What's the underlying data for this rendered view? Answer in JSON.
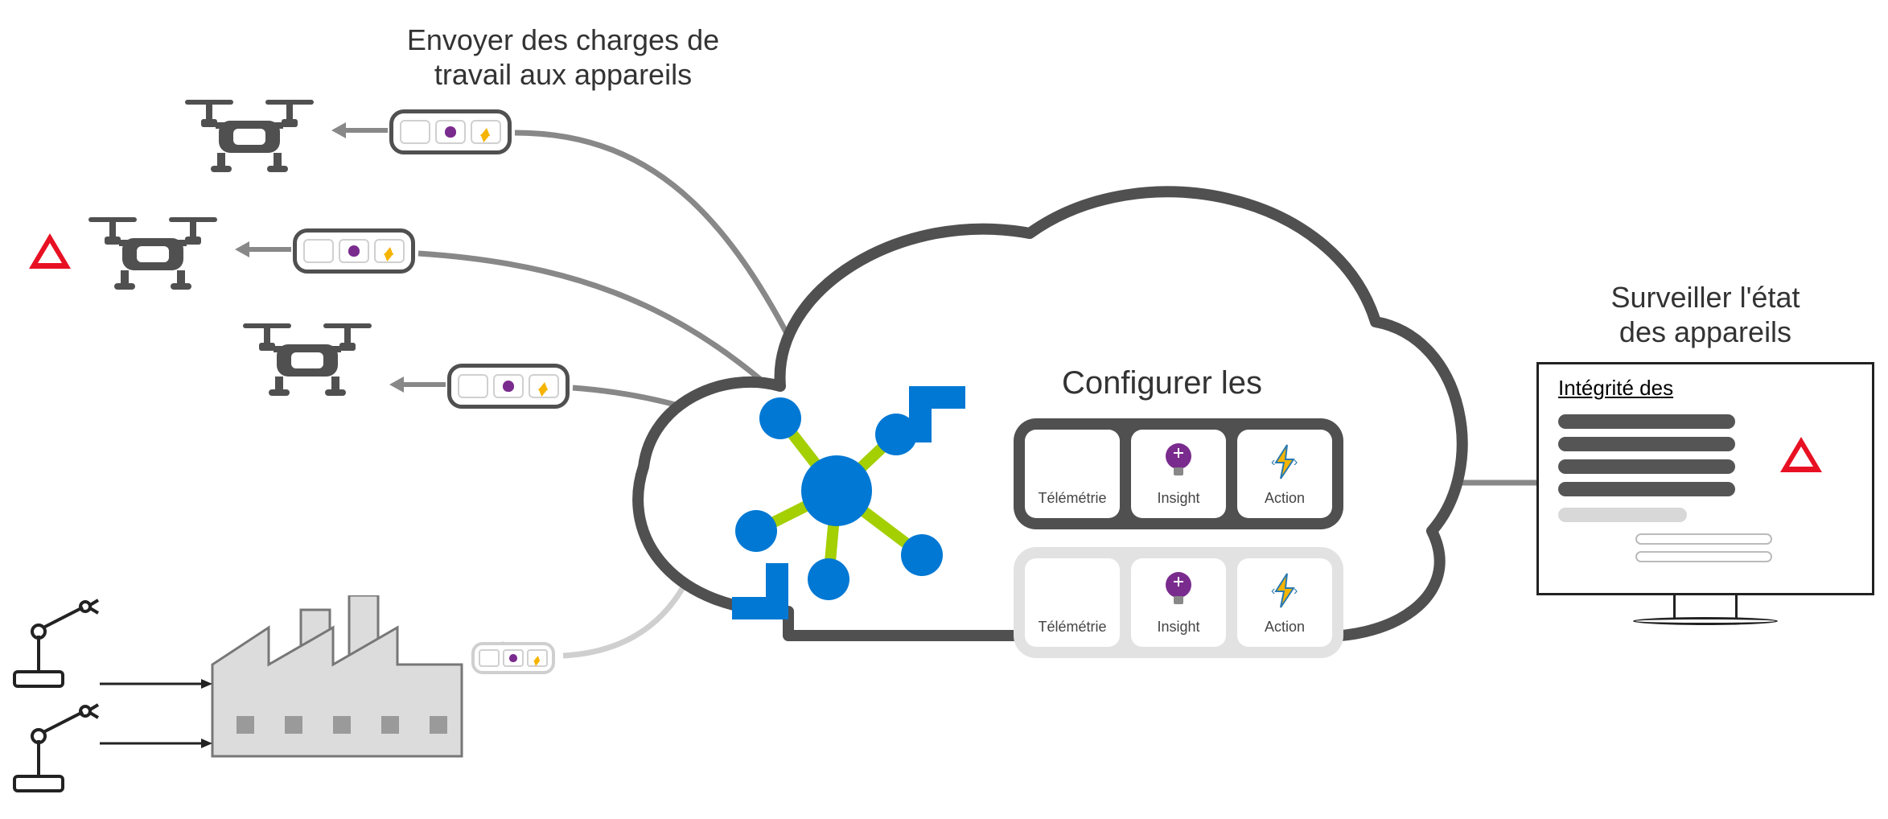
{
  "labels": {
    "send_workloads": "Envoyer des charges de\ntravail aux appareils",
    "configure": "Configurer les",
    "monitor_health": "Surveiller l'état\ndes appareils",
    "monitor_panel_title": "Intégrité des"
  },
  "modules": {
    "telemetry": "Télémétrie",
    "insight": "Insight",
    "action": "Action"
  },
  "icons": {
    "drone": "drone",
    "factory": "factory",
    "robot_arm": "robot-arm",
    "cloud": "cloud",
    "iot_hub": "iot-hub",
    "monitor": "monitor",
    "warning": "warning-triangle",
    "lightbulb": "lightbulb",
    "bolt": "lightning-bolt"
  },
  "colors": {
    "dark_gray": "#505050",
    "light_gray": "#cfcfcf",
    "azure_blue": "#0078d4",
    "green": "#a4cf00",
    "purple": "#7a2b8e",
    "yellow": "#f5b400",
    "red": "#e81123"
  }
}
